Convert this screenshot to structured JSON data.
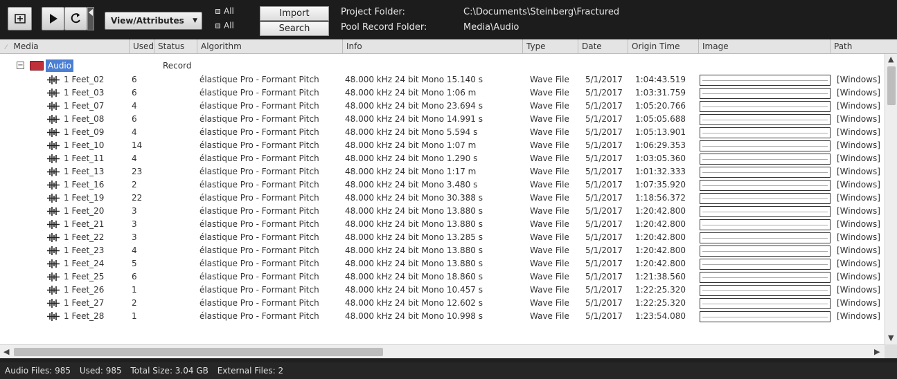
{
  "toolbar": {
    "view_attributes_label": "View/Attributes",
    "all_label_1": "All",
    "all_label_2": "All",
    "import_label": "Import",
    "search_label": "Search",
    "project_folder_label": "Project Folder:",
    "project_folder_value": "C:\\Documents\\Steinberg\\Fractured",
    "pool_record_folder_label": "Pool Record Folder:",
    "pool_record_folder_value": "Media\\Audio",
    "icons": [
      "settings-panel-icon",
      "play-icon",
      "loop-icon"
    ]
  },
  "columns": [
    "Media",
    "Used",
    "Status",
    "Algorithm",
    "Info",
    "Type",
    "Date",
    "Origin Time",
    "Image",
    "Path"
  ],
  "folder": {
    "name": "Audio",
    "status": "Record"
  },
  "rows": [
    {
      "name": "1 Feet_02",
      "used": "6",
      "algorithm": "élastique Pro - Formant Pitch",
      "info": "48.000 kHz  24 bit  Mono  15.140 s",
      "type": "Wave File",
      "date": "5/1/2017",
      "origin": "1:04:43.519",
      "path": "[Windows]"
    },
    {
      "name": "1 Feet_03",
      "used": "6",
      "algorithm": "élastique Pro - Formant Pitch",
      "info": "48.000 kHz  24 bit  Mono  1:06 m",
      "type": "Wave File",
      "date": "5/1/2017",
      "origin": "1:03:31.759",
      "path": "[Windows]"
    },
    {
      "name": "1 Feet_07",
      "used": "4",
      "algorithm": "élastique Pro - Formant Pitch",
      "info": "48.000 kHz  24 bit  Mono  23.694 s",
      "type": "Wave File",
      "date": "5/1/2017",
      "origin": "1:05:20.766",
      "path": "[Windows]"
    },
    {
      "name": "1 Feet_08",
      "used": "6",
      "algorithm": "élastique Pro - Formant Pitch",
      "info": "48.000 kHz  24 bit  Mono  14.991 s",
      "type": "Wave File",
      "date": "5/1/2017",
      "origin": "1:05:05.688",
      "path": "[Windows]"
    },
    {
      "name": "1 Feet_09",
      "used": "4",
      "algorithm": "élastique Pro - Formant Pitch",
      "info": "48.000 kHz  24 bit  Mono  5.594 s",
      "type": "Wave File",
      "date": "5/1/2017",
      "origin": "1:05:13.901",
      "path": "[Windows]"
    },
    {
      "name": "1 Feet_10",
      "used": "14",
      "algorithm": "élastique Pro - Formant Pitch",
      "info": "48.000 kHz  24 bit  Mono  1:07 m",
      "type": "Wave File",
      "date": "5/1/2017",
      "origin": "1:06:29.353",
      "path": "[Windows]"
    },
    {
      "name": "1 Feet_11",
      "used": "4",
      "algorithm": "élastique Pro - Formant Pitch",
      "info": "48.000 kHz  24 bit  Mono  1.290 s",
      "type": "Wave File",
      "date": "5/1/2017",
      "origin": "1:03:05.360",
      "path": "[Windows]"
    },
    {
      "name": "1 Feet_13",
      "used": "23",
      "algorithm": "élastique Pro - Formant Pitch",
      "info": "48.000 kHz  24 bit  Mono  1:17 m",
      "type": "Wave File",
      "date": "5/1/2017",
      "origin": "1:01:32.333",
      "path": "[Windows]"
    },
    {
      "name": "1 Feet_16",
      "used": "2",
      "algorithm": "élastique Pro - Formant Pitch",
      "info": "48.000 kHz  24 bit  Mono  3.480 s",
      "type": "Wave File",
      "date": "5/1/2017",
      "origin": "1:07:35.920",
      "path": "[Windows]"
    },
    {
      "name": "1 Feet_19",
      "used": "22",
      "algorithm": "élastique Pro - Formant Pitch",
      "info": "48.000 kHz  24 bit  Mono  30.388 s",
      "type": "Wave File",
      "date": "5/1/2017",
      "origin": "1:18:56.372",
      "path": "[Windows]"
    },
    {
      "name": "1 Feet_20",
      "used": "3",
      "algorithm": "élastique Pro - Formant Pitch",
      "info": "48.000 kHz  24 bit  Mono  13.880 s",
      "type": "Wave File",
      "date": "5/1/2017",
      "origin": "1:20:42.800",
      "path": "[Windows]"
    },
    {
      "name": "1 Feet_21",
      "used": "3",
      "algorithm": "élastique Pro - Formant Pitch",
      "info": "48.000 kHz  24 bit  Mono  13.880 s",
      "type": "Wave File",
      "date": "5/1/2017",
      "origin": "1:20:42.800",
      "path": "[Windows]"
    },
    {
      "name": "1 Feet_22",
      "used": "3",
      "algorithm": "élastique Pro - Formant Pitch",
      "info": "48.000 kHz  24 bit  Mono  13.285 s",
      "type": "Wave File",
      "date": "5/1/2017",
      "origin": "1:20:42.800",
      "path": "[Windows]"
    },
    {
      "name": "1 Feet_23",
      "used": "4",
      "algorithm": "élastique Pro - Formant Pitch",
      "info": "48.000 kHz  24 bit  Mono  13.880 s",
      "type": "Wave File",
      "date": "5/1/2017",
      "origin": "1:20:42.800",
      "path": "[Windows]"
    },
    {
      "name": "1 Feet_24",
      "used": "5",
      "algorithm": "élastique Pro - Formant Pitch",
      "info": "48.000 kHz  24 bit  Mono  13.880 s",
      "type": "Wave File",
      "date": "5/1/2017",
      "origin": "1:20:42.800",
      "path": "[Windows]"
    },
    {
      "name": "1 Feet_25",
      "used": "6",
      "algorithm": "élastique Pro - Formant Pitch",
      "info": "48.000 kHz  24 bit  Mono  18.860 s",
      "type": "Wave File",
      "date": "5/1/2017",
      "origin": "1:21:38.560",
      "path": "[Windows]"
    },
    {
      "name": "1 Feet_26",
      "used": "1",
      "algorithm": "élastique Pro - Formant Pitch",
      "info": "48.000 kHz  24 bit  Mono  10.457 s",
      "type": "Wave File",
      "date": "5/1/2017",
      "origin": "1:22:25.320",
      "path": "[Windows]"
    },
    {
      "name": "1 Feet_27",
      "used": "2",
      "algorithm": "élastique Pro - Formant Pitch",
      "info": "48.000 kHz  24 bit  Mono  12.602 s",
      "type": "Wave File",
      "date": "5/1/2017",
      "origin": "1:22:25.320",
      "path": "[Windows]"
    },
    {
      "name": "1 Feet_28",
      "used": "1",
      "algorithm": "élastique Pro - Formant Pitch",
      "info": "48.000 kHz  24 bit  Mono  10.998 s",
      "type": "Wave File",
      "date": "5/1/2017",
      "origin": "1:23:54.080",
      "path": "[Windows]"
    }
  ],
  "status_bar": {
    "audio_files": "Audio Files: 985",
    "used": "Used: 985",
    "total_size": "Total Size: 3.04 GB",
    "external_files": "External Files: 2"
  },
  "colors": {
    "toolbar_bg": "#1c1c1c",
    "header_bg": "#e4e4e4",
    "selection": "#4a7fd4",
    "folder_icon": "#c0303a"
  }
}
